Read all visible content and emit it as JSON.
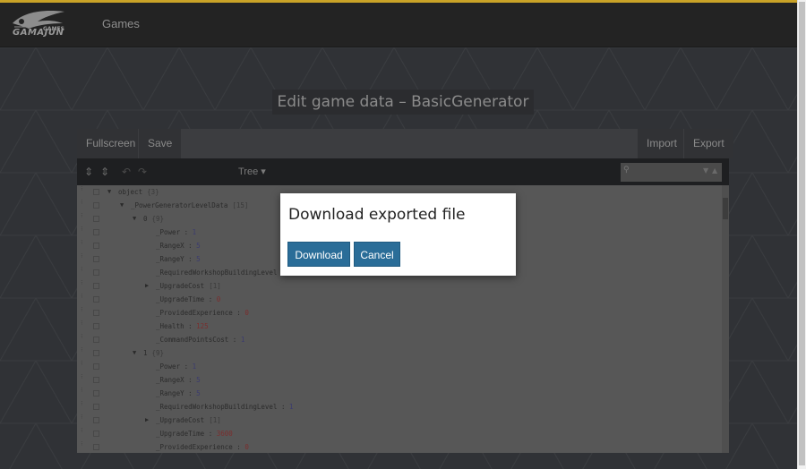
{
  "nav": {
    "logo_text": "GAMAJUN",
    "logo_sub": "GAMES",
    "games_label": "Games"
  },
  "page": {
    "title": "Edit game data – BasicGenerator"
  },
  "toolbar": {
    "fullscreen_label": "Fullscreen",
    "save_label": "Save",
    "import_label": "Import",
    "export_label": "Export"
  },
  "editor_menu": {
    "mode_label": "Tree ▾",
    "expand_icon": "expand-all-icon",
    "collapse_icon": "collapse-all-icon",
    "undo_icon": "undo-icon",
    "redo_icon": "redo-icon",
    "search_icon": "search-icon"
  },
  "tree": {
    "rows": [
      {
        "indent": 0,
        "toggle": "▼",
        "key": "object",
        "sep": "",
        "value": "",
        "count": "{3}"
      },
      {
        "indent": 1,
        "toggle": "▼",
        "key": "_PowerGeneratorLevelData",
        "sep": "",
        "value": "",
        "count": "[15]"
      },
      {
        "indent": 2,
        "toggle": "▼",
        "key": "0",
        "sep": "",
        "value": "",
        "count": "{9}"
      },
      {
        "indent": 3,
        "toggle": "",
        "key": "_Power",
        "sep": " : ",
        "value": "1",
        "count": ""
      },
      {
        "indent": 3,
        "toggle": "",
        "key": "_RangeX",
        "sep": " : ",
        "value": "5",
        "count": ""
      },
      {
        "indent": 3,
        "toggle": "",
        "key": "_RangeY",
        "sep": " : ",
        "value": "5",
        "count": ""
      },
      {
        "indent": 3,
        "toggle": "",
        "key": "_RequiredWorkshopBuildingLevel",
        "sep": "",
        "value": "",
        "count": ""
      },
      {
        "indent": 3,
        "toggle": "▶",
        "key": "_UpgradeCost",
        "sep": "",
        "value": "",
        "count": "[1]"
      },
      {
        "indent": 3,
        "toggle": "",
        "key": "_UpgradeTime",
        "sep": " : ",
        "value": "0",
        "count": ""
      },
      {
        "indent": 3,
        "toggle": "",
        "key": "_ProvidedExperience",
        "sep": " : ",
        "value": "0",
        "count": ""
      },
      {
        "indent": 3,
        "toggle": "",
        "key": "_Health",
        "sep": " : ",
        "value": "125",
        "count": ""
      },
      {
        "indent": 3,
        "toggle": "",
        "key": "_CommandPointsCost",
        "sep": " : ",
        "value": "1",
        "count": ""
      },
      {
        "indent": 2,
        "toggle": "▼",
        "key": "1",
        "sep": "",
        "value": "",
        "count": "{9}"
      },
      {
        "indent": 3,
        "toggle": "",
        "key": "_Power",
        "sep": " : ",
        "value": "1",
        "count": ""
      },
      {
        "indent": 3,
        "toggle": "",
        "key": "_RangeX",
        "sep": " : ",
        "value": "5",
        "count": ""
      },
      {
        "indent": 3,
        "toggle": "",
        "key": "_RangeY",
        "sep": " : ",
        "value": "5",
        "count": ""
      },
      {
        "indent": 3,
        "toggle": "",
        "key": "_RequiredWorkshopBuildingLevel",
        "sep": " : ",
        "value": "1",
        "count": ""
      },
      {
        "indent": 3,
        "toggle": "▶",
        "key": "_UpgradeCost",
        "sep": "",
        "value": "",
        "count": "[1]"
      },
      {
        "indent": 3,
        "toggle": "",
        "key": "_UpgradeTime",
        "sep": " : ",
        "value": "3600",
        "count": ""
      },
      {
        "indent": 3,
        "toggle": "",
        "key": "_ProvidedExperience",
        "sep": " : ",
        "value": "0",
        "count": ""
      }
    ]
  },
  "modal": {
    "title": "Download exported file",
    "download_label": "Download",
    "cancel_label": "Cancel"
  },
  "colors": {
    "accent": "#c9a227",
    "button_blue": "#2a6d98"
  }
}
